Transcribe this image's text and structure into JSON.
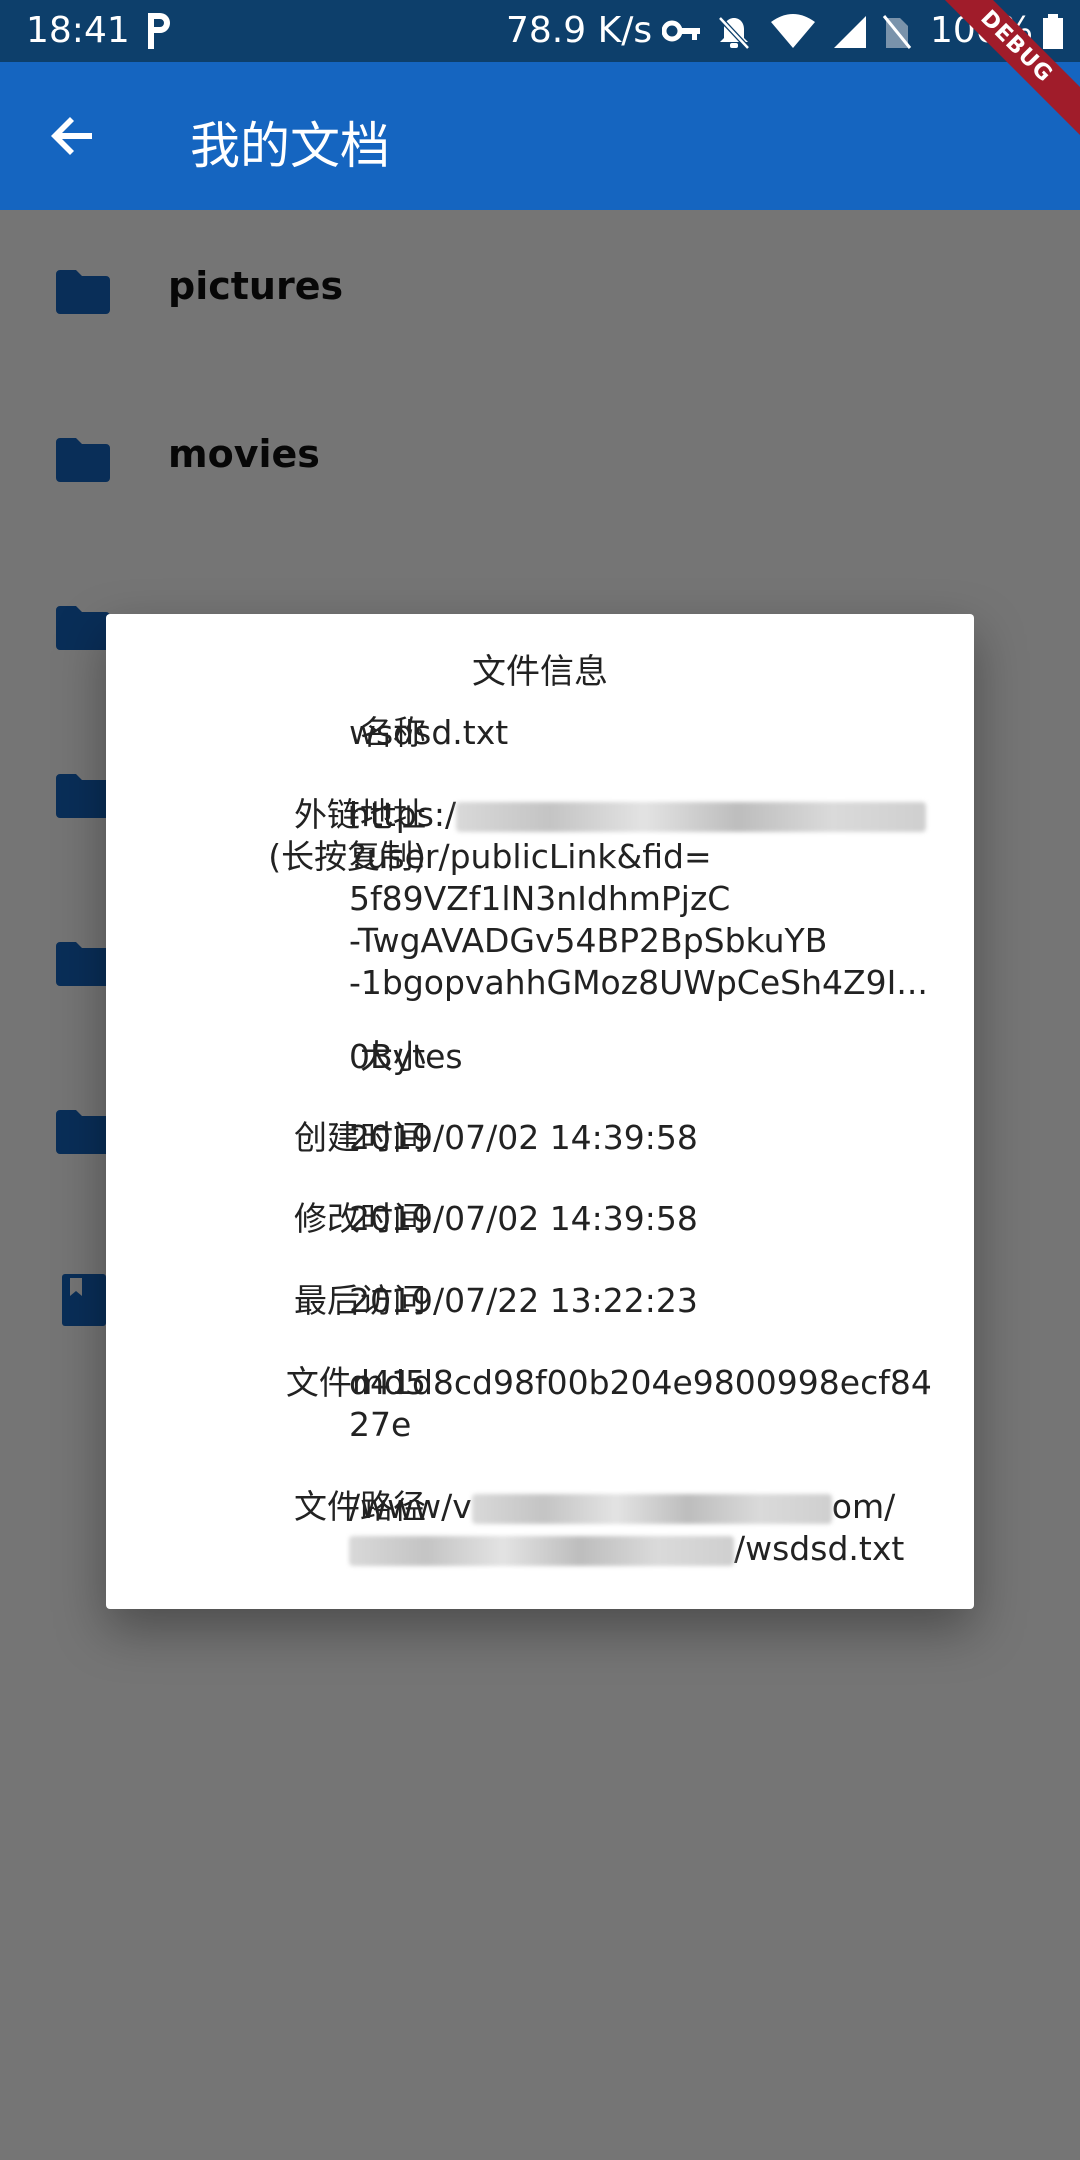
{
  "status_bar": {
    "time": "18:41",
    "net_speed": "78.9 K/s",
    "battery": "100%",
    "icons": [
      "p-icon",
      "key-icon",
      "bell-off-icon",
      "wifi-icon",
      "signal-icon",
      "no-sim-icon",
      "battery-icon"
    ]
  },
  "debug_banner": "DEBUG",
  "app_bar": {
    "title": "我的文档"
  },
  "list": {
    "items": [
      {
        "label": "pictures",
        "icon": "folder-icon"
      },
      {
        "label": "movies",
        "icon": "folder-icon"
      }
    ]
  },
  "dialog": {
    "title": "文件信息",
    "fields": {
      "name": {
        "key": "名称",
        "value": "wsdsd.txt"
      },
      "link": {
        "key": "外链地址\n(长按复制)",
        "line1": "https:/",
        "line2": "?user/publicLink&fid=",
        "line3": "5f89VZf1lN3nIdhmPjzC",
        "line4": "-TwgAVADGv54BP2BpSbkuYB",
        "line5": "-1bgopvahhGMoz8UWpCeSh4Z9I..."
      },
      "size": {
        "key": "大小",
        "value": "0Bytes"
      },
      "created": {
        "key": "创建时间",
        "value": "2019/07/02 14:39:58"
      },
      "modified": {
        "key": "修改时间",
        "value": "2019/07/02 14:39:58"
      },
      "accessed": {
        "key": "最后访问",
        "value": "2019/07/22 13:22:23"
      },
      "md5": {
        "key": "文件md5",
        "value": "d41d8cd98f00b204e9800998ecf8427e"
      },
      "path": {
        "key": "文件路径",
        "line1_start": "/www/v",
        "line1_end": "om/",
        "line2_end": "/wsdsd.txt"
      }
    }
  },
  "colors": {
    "app_bar": "#1565c0",
    "status_bar": "#0d3f6b",
    "folder": "#1565c0",
    "debug": "#a01c2a"
  }
}
